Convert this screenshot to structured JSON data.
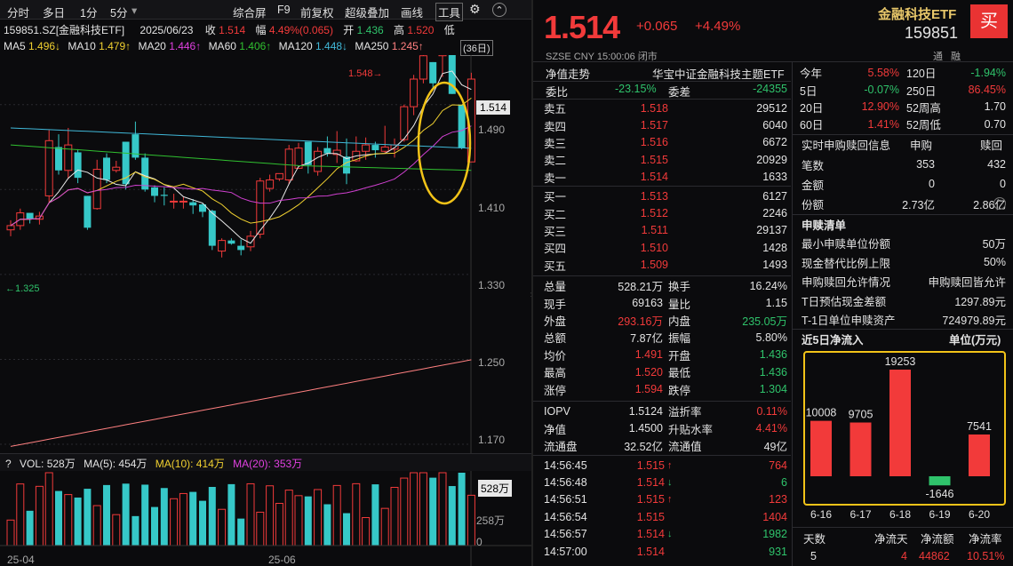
{
  "toolbar": {
    "fenshi": "分时",
    "multiday": "多日",
    "p1": "1分",
    "p5": "5分",
    "p5_caret": "▾",
    "zonghe": "综合屏",
    "f9": "F9",
    "qianfuquan": "前复权",
    "chaoji": "超级叠加",
    "huaxian": "画线",
    "gongju": "工具",
    "gear": "⚙",
    "up": "⌃"
  },
  "info": {
    "code": "159851.SZ[金融科技ETF]",
    "date": "2025/06/23",
    "close_label": "收",
    "close": "1.514",
    "amp_label": "幅",
    "amp": "4.49%(0.065)",
    "open_label": "开",
    "open": "1.436",
    "high_label": "高",
    "high": "1.520",
    "low_label": "低"
  },
  "ma": {
    "ma5": "MA5",
    "ma5v": "1.496↓",
    "ma10": "MA10",
    "ma10v": "1.479↑",
    "ma20": "MA20",
    "ma20v": "1.446↑",
    "ma60": "MA60",
    "ma60v": "1.406↑",
    "ma120": "MA120",
    "ma120v": "1.448↓",
    "ma250": "MA250",
    "ma250v": "1.245↑",
    "period": "(36日)"
  },
  "colors": {
    "up": "#f23a3a",
    "down": "#36c8c8",
    "ma5": "#e8e8e8",
    "ma10": "#f0d030",
    "ma20": "#d040d0",
    "ma60": "#30c030",
    "ma120": "#40b8d8",
    "ma250": "#ff8080",
    "highlight": "#f2c318"
  },
  "price_axis": {
    "ticks": [
      "1.490",
      "1.410",
      "1.330",
      "1.250",
      "1.170"
    ],
    "current": "1.514"
  },
  "annot": {
    "high": "1.548",
    "low": "1.325"
  },
  "vol": {
    "label": "VOL: 528万",
    "ma5": "MA(5): 454万",
    "ma10": "MA(10): 414万",
    "ma20": "MA(20): 353万",
    "current": "528万",
    "mid": "258万",
    "zero": "0",
    "q": "?"
  },
  "xaxis": [
    "25-04",
    "25-06"
  ],
  "chart_data": {
    "type": "candlestick",
    "candles": [
      [
        1.372,
        1.381,
        1.366,
        1.376
      ],
      [
        1.376,
        1.392,
        1.372,
        1.388
      ],
      [
        1.388,
        1.384,
        1.378,
        1.382
      ],
      [
        1.382,
        1.389,
        1.377,
        1.385
      ],
      [
        1.404,
        1.466,
        1.398,
        1.456
      ],
      [
        1.45,
        1.462,
        1.424,
        1.428
      ],
      [
        1.428,
        1.468,
        1.42,
        1.452
      ],
      [
        1.445,
        1.448,
        1.416,
        1.421
      ],
      [
        1.404,
        1.404,
        1.372,
        1.374
      ],
      [
        1.392,
        1.438,
        1.391,
        1.429
      ],
      [
        1.44,
        1.444,
        1.416,
        1.419
      ],
      [
        1.428,
        1.437,
        1.426,
        1.431
      ],
      [
        1.455,
        1.44,
        1.41,
        1.415
      ],
      [
        1.462,
        1.474,
        1.438,
        1.44
      ],
      [
        1.44,
        1.444,
        1.408,
        1.41
      ],
      [
        1.412,
        1.414,
        1.398,
        1.404
      ],
      [
        1.405,
        1.412,
        1.395,
        1.404
      ],
      [
        1.399,
        1.406,
        1.392,
        1.399
      ],
      [
        1.399,
        1.403,
        1.392,
        1.399
      ],
      [
        1.398,
        1.401,
        1.387,
        1.395
      ],
      [
        1.396,
        1.397,
        1.384,
        1.389
      ],
      [
        1.39,
        1.391,
        1.353,
        1.357
      ],
      [
        1.352,
        1.364,
        1.346,
        1.362
      ],
      [
        1.362,
        1.364,
        1.358,
        1.359
      ],
      [
        1.357,
        1.363,
        1.348,
        1.353
      ],
      [
        1.356,
        1.371,
        1.352,
        1.366
      ],
      [
        1.368,
        1.421,
        1.364,
        1.418
      ],
      [
        1.411,
        1.424,
        1.408,
        1.419
      ],
      [
        1.42,
        1.425,
        1.418,
        1.425
      ],
      [
        1.419,
        1.452,
        1.415,
        1.448
      ],
      [
        1.43,
        1.454,
        1.43,
        1.449
      ],
      [
        1.455,
        1.455,
        1.425,
        1.433
      ],
      [
        1.427,
        1.45,
        1.423,
        1.446
      ],
      [
        1.449,
        1.46,
        1.441,
        1.444
      ],
      [
        1.443,
        1.465,
        1.435,
        1.447
      ],
      [
        1.441,
        1.458,
        1.415,
        1.425
      ],
      [
        1.437,
        1.46,
        1.436,
        1.446
      ],
      [
        1.446,
        1.459,
        1.438,
        1.452
      ],
      [
        1.452,
        1.455,
        1.44,
        1.447
      ],
      [
        1.446,
        1.47,
        1.444,
        1.45
      ],
      [
        1.448,
        1.458,
        1.44,
        1.452
      ],
      [
        1.457,
        1.49,
        1.455,
        1.488
      ],
      [
        1.488,
        1.518,
        1.48,
        1.514
      ],
      [
        1.514,
        1.548,
        1.51,
        1.536
      ],
      [
        1.53,
        1.53,
        1.505,
        1.51
      ],
      [
        1.536,
        1.548,
        1.516,
        1.548
      ],
      [
        1.545,
        1.548,
        1.5,
        1.5
      ],
      [
        1.49,
        1.478,
        1.448,
        1.449
      ],
      [
        1.436,
        1.52,
        1.436,
        1.514
      ]
    ]
  },
  "quote": {
    "price": "1.514",
    "change": "+0.065",
    "pct": "+4.49%",
    "time": "SZSE  CNY  15:00:06  闭市",
    "name": "金融科技ETF",
    "code": "159851",
    "buy_btn": "买",
    "tong": "通",
    "rong": "融"
  },
  "nav": {
    "label": "净值走势",
    "fund": "华宝中证金融科技主题ETF",
    "weibi_l": "委比",
    "weibi": "-23.15%",
    "weicha_l": "委差",
    "weicha": "-24355"
  },
  "asks": [
    {
      "l": "卖五",
      "p": "1.518",
      "v": "29512"
    },
    {
      "l": "卖四",
      "p": "1.517",
      "v": "6040"
    },
    {
      "l": "卖三",
      "p": "1.516",
      "v": "6672"
    },
    {
      "l": "卖二",
      "p": "1.515",
      "v": "20929"
    },
    {
      "l": "卖一",
      "p": "1.514",
      "v": "1633"
    }
  ],
  "bids": [
    {
      "l": "买一",
      "p": "1.513",
      "v": "6127"
    },
    {
      "l": "买二",
      "p": "1.512",
      "v": "2246"
    },
    {
      "l": "买三",
      "p": "1.511",
      "v": "29137"
    },
    {
      "l": "买四",
      "p": "1.510",
      "v": "1428"
    },
    {
      "l": "买五",
      "p": "1.509",
      "v": "1493"
    }
  ],
  "stats": [
    [
      "总量",
      "528.21万",
      "w",
      "换手",
      "16.24%",
      "w"
    ],
    [
      "现手",
      "69163",
      "w",
      "量比",
      "1.15",
      "w"
    ],
    [
      "外盘",
      "293.16万",
      "r",
      "内盘",
      "235.05万",
      "g"
    ],
    [
      "总额",
      "7.87亿",
      "w",
      "振幅",
      "5.80%",
      "w"
    ],
    [
      "均价",
      "1.491",
      "r",
      "开盘",
      "1.436",
      "g"
    ],
    [
      "最高",
      "1.520",
      "r",
      "最低",
      "1.436",
      "g"
    ],
    [
      "涨停",
      "1.594",
      "r",
      "跌停",
      "1.304",
      "g"
    ]
  ],
  "iopv": [
    [
      "IOPV",
      "1.5124",
      "w",
      "溢折率",
      "0.11%",
      "r"
    ],
    [
      "净值",
      "1.4500",
      "w",
      "升贴水率",
      "4.41%",
      "r"
    ],
    [
      "流通盘",
      "32.52亿",
      "w",
      "流通值",
      "49亿",
      "w"
    ]
  ],
  "ticks": [
    {
      "t": "14:56:45",
      "p": "1.515",
      "a": "↑",
      "v": "764",
      "c": "r"
    },
    {
      "t": "14:56:48",
      "p": "1.514",
      "a": "↓",
      "v": "6",
      "c": "g"
    },
    {
      "t": "14:56:51",
      "p": "1.515",
      "a": "↑",
      "v": "123",
      "c": "r"
    },
    {
      "t": "14:56:54",
      "p": "1.515",
      "a": "",
      "v": "1404",
      "c": "r"
    },
    {
      "t": "14:56:57",
      "p": "1.514",
      "a": "↓",
      "v": "1982",
      "c": "g"
    },
    {
      "t": "14:57:00",
      "p": "1.514",
      "a": "",
      "v": "931",
      "c": "g"
    }
  ],
  "periods": [
    [
      "今年",
      "5.58%",
      "r",
      "120日",
      "-1.94%",
      "g"
    ],
    [
      "5日",
      "-0.07%",
      "g",
      "250日",
      "86.45%",
      "r"
    ],
    [
      "20日",
      "12.90%",
      "r",
      "52周高",
      "1.70",
      "w"
    ],
    [
      "60日",
      "1.41%",
      "r",
      "52周低",
      "0.70",
      "w"
    ]
  ],
  "creation": {
    "title": "实时申购赎回信息",
    "sub": "申购",
    "red": "赎回",
    "rows": [
      [
        "笔数",
        "353",
        "432"
      ],
      [
        "金额",
        "0",
        "0"
      ],
      [
        "份额",
        "2.73亿",
        "2.86亿"
      ]
    ]
  },
  "list": {
    "title": "申赎清单",
    "rows": [
      [
        "最小申赎单位份额",
        "50万"
      ],
      [
        "现金替代比例上限",
        "50%"
      ],
      [
        "申购赎回允许情况",
        "申购赎回皆允许"
      ],
      [
        "T日预估现金差额",
        "1297.89元"
      ],
      [
        "T-1日单位申赎资产",
        "724979.89元"
      ]
    ]
  },
  "flow": {
    "title": "近5日净流入",
    "unit": "单位(万元)",
    "bars": [
      {
        "d": "6-16",
        "v": 10008
      },
      {
        "d": "6-17",
        "v": 9705
      },
      {
        "d": "6-18",
        "v": 19253
      },
      {
        "d": "6-19",
        "v": -1646
      },
      {
        "d": "6-20",
        "v": 7541
      }
    ],
    "labels": [
      "10008",
      "9705",
      "19253",
      "-1646",
      "7541"
    ]
  },
  "flow_footer": {
    "h1": "天数",
    "h2": "净流天",
    "h3": "净流额",
    "h4": "净流率",
    "v1": "5",
    "v2": "4",
    "v3": "44862",
    "v4": "10.51%"
  }
}
